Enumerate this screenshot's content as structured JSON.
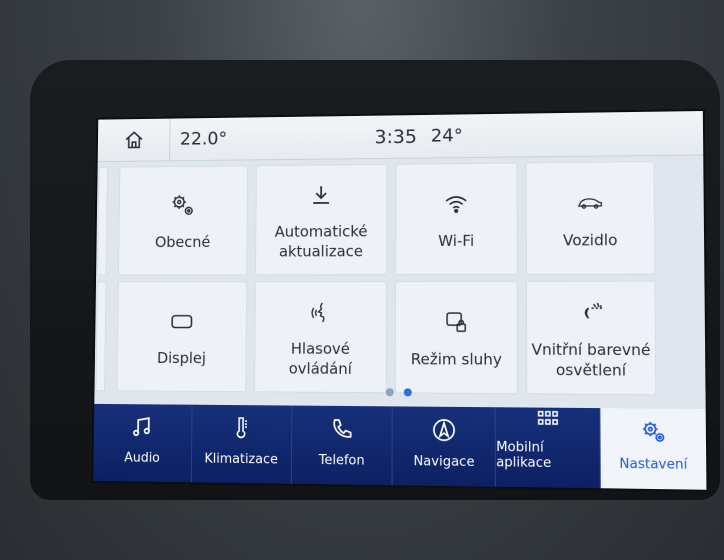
{
  "status_bar": {
    "inside_temp": "22.0°",
    "time": "3:35",
    "outside_temp": "24°"
  },
  "tiles": [
    {
      "label": "Obecné",
      "icon": "gears-icon"
    },
    {
      "label": "Automatické\naktualizace",
      "icon": "download-icon"
    },
    {
      "label": "Wi-Fi",
      "icon": "wifi-icon"
    },
    {
      "label": "Vozidlo",
      "icon": "car-icon"
    },
    {
      "label": "Displej",
      "icon": "display-icon"
    },
    {
      "label": "Hlasové\novládání",
      "icon": "voice-icon"
    },
    {
      "label": "Režim sluhy",
      "icon": "valet-lock-icon"
    },
    {
      "label": "Vnitřní barevné\nosvětlení",
      "icon": "ambient-light-icon"
    }
  ],
  "pager": {
    "pages": 2,
    "active": 2
  },
  "nav": [
    {
      "label": "Audio",
      "icon": "music-note-icon"
    },
    {
      "label": "Klimatizace",
      "icon": "thermometer-icon"
    },
    {
      "label": "Telefon",
      "icon": "phone-icon"
    },
    {
      "label": "Navigace",
      "icon": "compass-icon"
    },
    {
      "label": "Mobilní aplikace",
      "icon": "apps-grid-icon"
    },
    {
      "label": "Nastavení",
      "icon": "settings-gears-icon",
      "active": true
    }
  ],
  "colors": {
    "nav_bg": "#16307a",
    "accent": "#1e5be0",
    "screen_bg": "#dfe6ee"
  }
}
